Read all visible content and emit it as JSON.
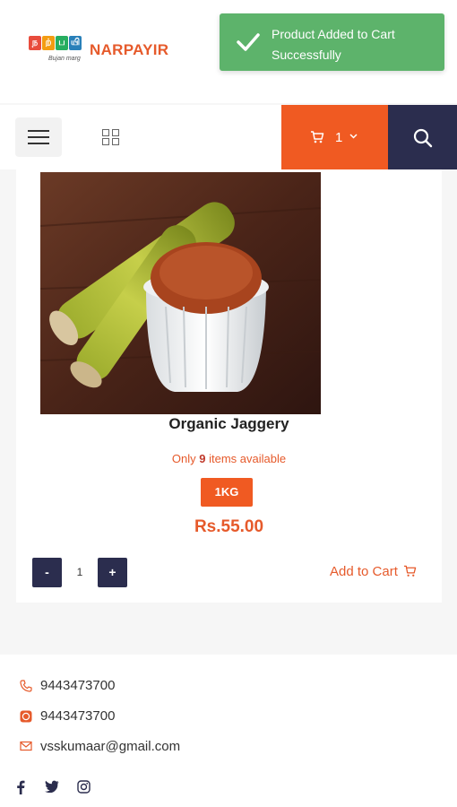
{
  "header": {
    "logo_text": "NARPAYIR",
    "logo_tagline": "Bujan marg"
  },
  "toast": {
    "message": "Product Added to Cart Successfully",
    "color": "#5db36b"
  },
  "navbar": {
    "menu_icon": "hamburger-icon",
    "grid_icon": "grid-icon",
    "cart_count": "1",
    "cart_color": "#f05a22",
    "search_color": "#2b2d4e"
  },
  "product": {
    "title": "Organic Jaggery",
    "stock_prefix": "Only ",
    "stock_count": "9",
    "stock_suffix": " items available",
    "variant": "1KG",
    "price": "Rs.55.00",
    "qty_minus": "-",
    "qty_value": "1",
    "qty_plus": "+",
    "add_to_cart": "Add to Cart"
  },
  "footer": {
    "phone": "9443473700",
    "whatsapp": "9443473700",
    "email": "vsskumaar@gmail.com",
    "social": [
      "facebook-icon",
      "twitter-icon",
      "instagram-icon"
    ]
  }
}
